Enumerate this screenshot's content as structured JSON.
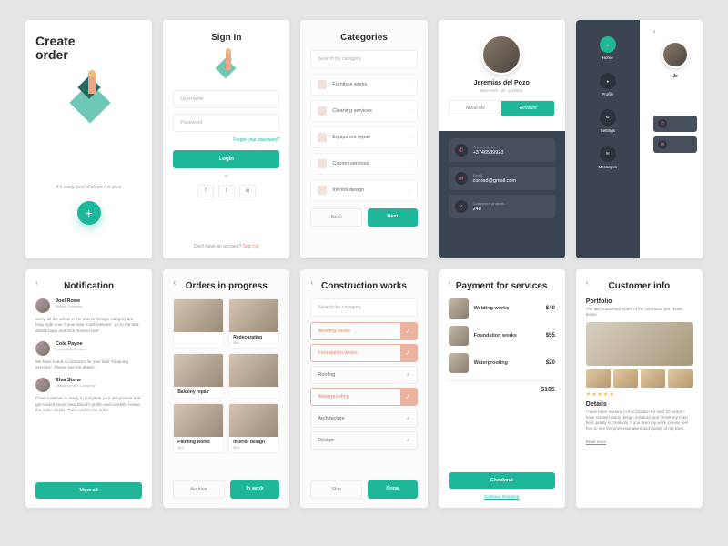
{
  "s1": {
    "title": "Create\norder",
    "sub": "It's easy, just click on the plus"
  },
  "s2": {
    "title": "Sign In",
    "user": "Username",
    "pass": "Password",
    "forgot": "Forgot your password?",
    "login": "Login",
    "or": "or",
    "noacct": "Don't have an account? ",
    "signup": "Sign Up"
  },
  "s3": {
    "title": "Categories",
    "search": "Search by category",
    "items": [
      "Furniture works",
      "Cleaning services",
      "Equipment repair",
      "Courier services",
      "Interior design"
    ],
    "back": "Back",
    "next": "Next"
  },
  "s4": {
    "name": "Jeremias del Pozo",
    "loc": "New York",
    "id": "ID: 1120611",
    "about": "About Me",
    "reviews": "Reviews",
    "phone_l": "Phone number",
    "phone": "+3746589923",
    "email_l": "Email",
    "email": "conrad@gmail.com",
    "proj_l": "Completed projects",
    "proj": "248"
  },
  "s5": {
    "items": [
      "Home",
      "Profile",
      "Settings",
      "Messages"
    ],
    "pname": "Je"
  },
  "s6": {
    "title": "Notification",
    "n": [
      {
        "nm": "Joel Rowe",
        "co": "Bitrow Company",
        "tx": "Sorry, all the artists in the Interior Design category are busy right now. If your task is still relevant - go to the task details page and click \"Extend task\"."
      },
      {
        "nm": "Cole Payne",
        "co": "Corporation Kraton",
        "tx": "We have found a contractor for your task \"Cleaning services\". Please see the details."
      },
      {
        "nm": "Elva Stone",
        "co": "Grand Service Company",
        "tx": "David Coleman is ready to complete your assignment and get started soon! View David's profile and carefully review the order details. Then confirm the order."
      }
    ],
    "view": "View all"
  },
  "s7": {
    "title": "Orders in progress",
    "tiles": [
      {
        "t": "",
        "s": ""
      },
      {
        "t": "Redecorating",
        "s": "$60"
      },
      {
        "t": "Balcony repair",
        "s": ""
      },
      {
        "t": "",
        "s": ""
      },
      {
        "t": "Painting works",
        "s": "$42"
      },
      {
        "t": "Interior design",
        "s": "$54"
      }
    ],
    "archive": "Archive",
    "inwork": "In work"
  },
  "s8": {
    "title": "Construction works",
    "search": "Search by category",
    "items": [
      {
        "l": "Welding works",
        "on": true
      },
      {
        "l": "Foundation works",
        "on": true
      },
      {
        "l": "Roofing",
        "on": false
      },
      {
        "l": "Waterproofing",
        "on": true
      },
      {
        "l": "Architecture",
        "on": false
      },
      {
        "l": "Design",
        "on": false
      }
    ],
    "skip": "Skip",
    "done": "Done"
  },
  "s9": {
    "title": "Payment for services",
    "items": [
      {
        "n": "Welding works",
        "p": "$40"
      },
      {
        "n": "Foundation works",
        "p": "$55"
      },
      {
        "n": "Waterproofing",
        "p": "$20"
      }
    ],
    "total": "$105",
    "checkout": "Checkout",
    "cont": "Continue Shopping"
  },
  "s10": {
    "title": "Customer info",
    "portfolio": "Portfolio",
    "psub": "The last completed works of the contractor are shown below.",
    "details": "Details",
    "dtx": "I have been working in this position for over 10 years! I have created many design solutions and I think my main best quality is creativity. If you liked my work, please feel free to see the professionalism and quality of my work.",
    "read": "Read more"
  }
}
